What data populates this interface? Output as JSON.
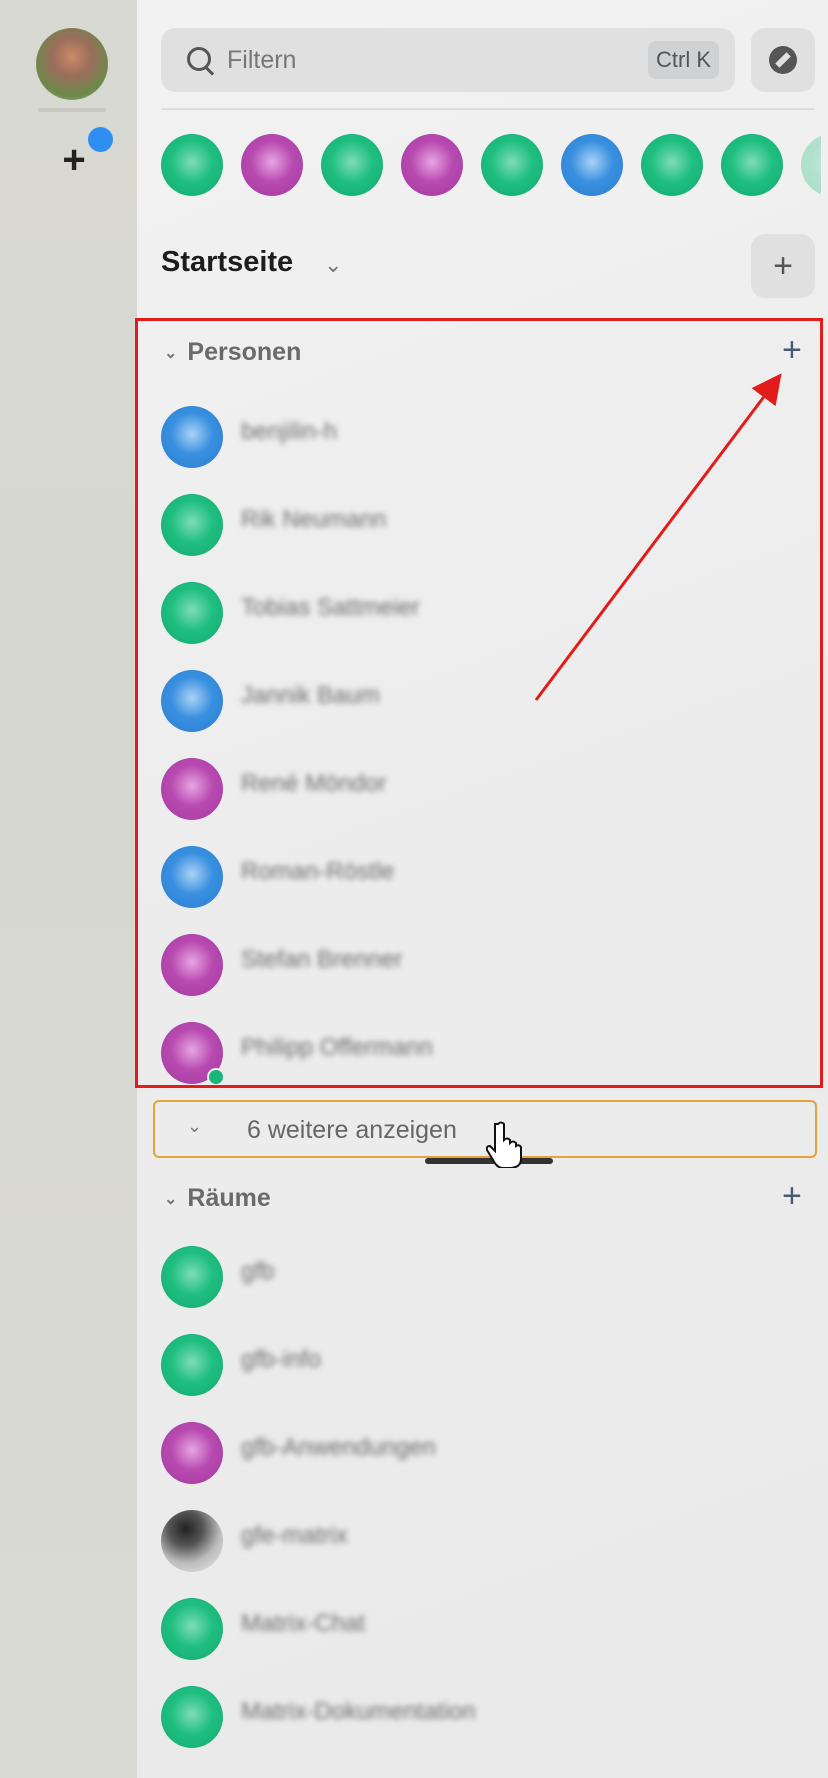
{
  "search": {
    "placeholder": "Filtern",
    "shortcut": "Ctrl K"
  },
  "home": {
    "title": "Startseite"
  },
  "sections": {
    "people": {
      "title": "Personen",
      "show_more": "6 weitere anzeigen"
    },
    "rooms": {
      "title": "Räume"
    }
  },
  "people": [
    {
      "name": "benjilin-h",
      "color": "#2f88de"
    },
    {
      "name": "Rik Neumann",
      "color": "#1fbf81"
    },
    {
      "name": "Tobias Sattmeier",
      "color": "#1fbf81"
    },
    {
      "name": "Jannik Baum",
      "color": "#2f88de"
    },
    {
      "name": "René Möndor",
      "color": "#b84ab1"
    },
    {
      "name": "Roman-Röstle",
      "color": "#2f88de"
    },
    {
      "name": "Stefan Brenner",
      "color": "#b84ab1"
    },
    {
      "name": "Philipp Offermann",
      "color": "#b84ab1"
    }
  ],
  "rooms": [
    {
      "name": "gfb",
      "color": "#1fbf81"
    },
    {
      "name": "gfb-info",
      "color": "#1fbf81"
    },
    {
      "name": "gfb-Anwendungen",
      "color": "#b84ab1"
    },
    {
      "name": "gfe-matrix",
      "color": "photo"
    },
    {
      "name": "Matrix-Chat",
      "color": "#1fbf81"
    },
    {
      "name": "Matrix-Dokumentation",
      "color": "#1fbf81"
    }
  ],
  "icons": {
    "search": "search-icon",
    "explore": "compass-icon",
    "add": "plus-icon",
    "chevron": "chevron-down-icon"
  }
}
